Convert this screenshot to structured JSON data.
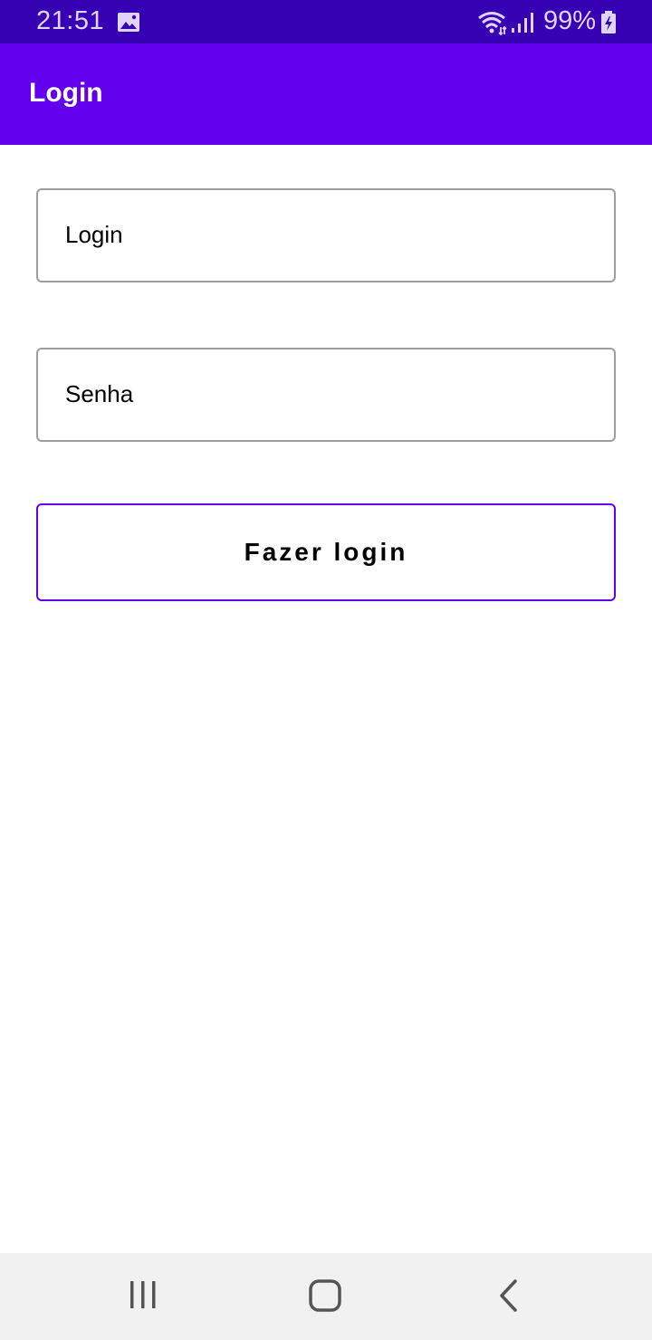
{
  "status_bar": {
    "time": "21:51",
    "battery": "99%",
    "icons": [
      "gallery-icon",
      "wifi-icon",
      "signal-icon",
      "battery-icon"
    ]
  },
  "app_bar": {
    "title": "Login"
  },
  "form": {
    "login_placeholder": "Login",
    "senha_placeholder": "Senha",
    "submit_label": "Fazer login"
  },
  "nav_bar": {
    "icons": [
      "recent-apps-icon",
      "home-icon",
      "back-icon"
    ]
  },
  "colors": {
    "status_bar": "#3700B3",
    "primary": "#6200EE",
    "background": "#FFFFFF",
    "nav_bar": "#F1F1F1"
  }
}
